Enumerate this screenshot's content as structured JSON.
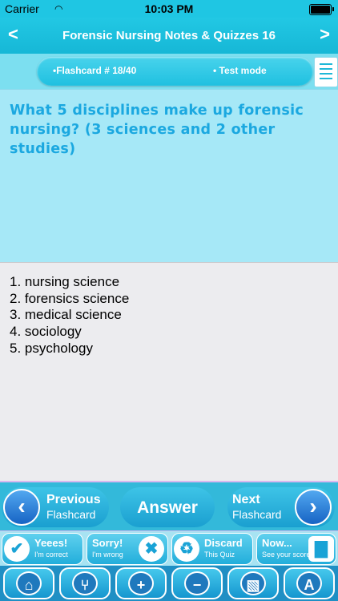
{
  "status_bar": {
    "carrier": "Carrier",
    "time": "10:03 PM"
  },
  "header": {
    "title": "Forensic Nursing Notes & Quizzes 16",
    "back": "<",
    "forward": ">"
  },
  "card_header": {
    "flashcard": "•Flashcard #  18/40",
    "mode": "• Test mode"
  },
  "question": "What 5 disciplines make up forensic nursing? (3 sciences and 2 other studies)",
  "answers": [
    "1. nursing science",
    "2. forensics science",
    "3. medical science",
    "4. sociology",
    "5. psychology"
  ],
  "nav": {
    "previous": {
      "label": "Previous",
      "sub": "Flashcard"
    },
    "answer": "Answer",
    "next": {
      "label": "Next",
      "sub": "Flashcard"
    }
  },
  "actions": [
    {
      "title": "Yeees!",
      "sub": "I'm correct",
      "icon": "check-icon"
    },
    {
      "title": "Sorry!",
      "sub": "I'm wrong",
      "icon": "cross-icon"
    },
    {
      "title": "Discard",
      "sub": "This Quiz",
      "icon": "recycle-icon"
    },
    {
      "title": "Now...",
      "sub": "See your score",
      "icon": "chart-icon"
    }
  ],
  "toolbar_icons": [
    "home-icon",
    "share-icon",
    "zoom-in-icon",
    "zoom-out-icon",
    "paint-bucket-icon",
    "font-icon"
  ],
  "colors": {
    "accent": "#1fc6e3",
    "question_text": "#1ba8e0",
    "question_bg": "#a6e8f7"
  }
}
